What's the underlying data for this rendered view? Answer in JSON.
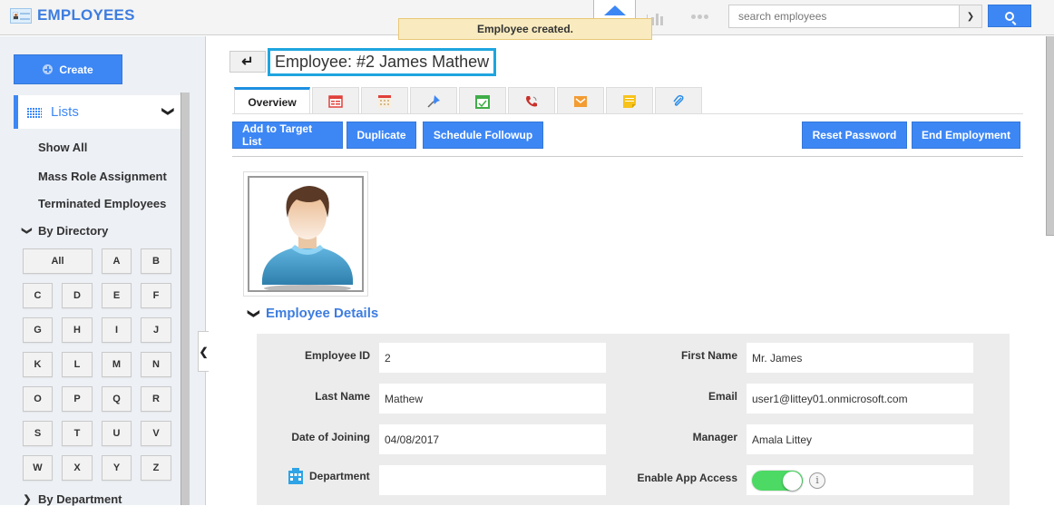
{
  "header": {
    "app_title": "EMPLOYEES",
    "search_placeholder": "search employees",
    "toast": "Employee created.",
    "icons": [
      "employees-icon",
      "home-icon",
      "reports-icon",
      "more-icon",
      "search-icon"
    ]
  },
  "sidebar": {
    "create_label": "Create",
    "lists_label": "Lists",
    "items": [
      {
        "label": "Show All"
      },
      {
        "label": "Mass Role Assignment"
      },
      {
        "label": "Terminated Employees"
      }
    ],
    "by_directory_label": "By Directory",
    "letters": [
      "All",
      "A",
      "B",
      "C",
      "D",
      "E",
      "F",
      "G",
      "H",
      "I",
      "J",
      "K",
      "L",
      "M",
      "N",
      "O",
      "P",
      "Q",
      "R",
      "S",
      "T",
      "U",
      "V",
      "W",
      "X",
      "Y",
      "Z"
    ],
    "by_department_label": "By Department"
  },
  "record": {
    "title": "Employee: #2 James Mathew",
    "tabs": [
      {
        "label": "Overview",
        "icon": "overview"
      },
      {
        "label": "",
        "icon": "details-icon"
      },
      {
        "label": "",
        "icon": "calendar-icon"
      },
      {
        "label": "",
        "icon": "pin-icon"
      },
      {
        "label": "",
        "icon": "task-icon"
      },
      {
        "label": "",
        "icon": "phone-icon"
      },
      {
        "label": "",
        "icon": "email-icon"
      },
      {
        "label": "",
        "icon": "note-icon"
      },
      {
        "label": "",
        "icon": "attachment-icon"
      }
    ],
    "actions_left": [
      "Add to Target List",
      "Duplicate",
      "Schedule Followup"
    ],
    "actions_right": [
      "Reset Password",
      "End Employment"
    ],
    "section_title": "Employee Details",
    "fields_left": [
      {
        "label": "Employee ID",
        "value": "2"
      },
      {
        "label": "Last Name",
        "value": "Mathew"
      },
      {
        "label": "Date of Joining",
        "value": "04/08/2017"
      },
      {
        "label": "Department",
        "value": ""
      }
    ],
    "fields_right": [
      {
        "label": "First Name",
        "value": "Mr. James"
      },
      {
        "label": "Email",
        "value": "user1@littey01.onmicrosoft.com"
      },
      {
        "label": "Manager",
        "value": "Amala Littey"
      },
      {
        "label": "Enable App Access",
        "value": "on"
      }
    ]
  },
  "colors": {
    "accent": "#3d87f5",
    "title_border": "#1ea5df",
    "toast_bg": "#f9ebbf",
    "toggle_on": "#4cd964"
  }
}
